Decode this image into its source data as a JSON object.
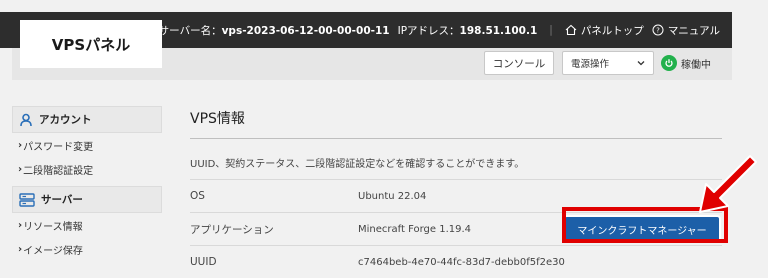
{
  "header": {
    "logo": "VPSパネル",
    "server_label": "サーバー名：",
    "server_name": "vps-2023-06-12-00-00-00-11",
    "ip_label": "IPアドレス：",
    "ip": "198.51.100.1",
    "separator": "|",
    "panel_top": "パネルトップ",
    "manual": "マニュアル"
  },
  "toolbar": {
    "console": "コンソール",
    "power_select": "電源操作",
    "status": "稼働中",
    "status_color": "#22b14c"
  },
  "sidebar": {
    "account_title": "アカウント",
    "account_items": [
      {
        "caret": "›",
        "label": "パスワード変更"
      },
      {
        "caret": "›",
        "label": "二段階認証設定"
      }
    ],
    "server_title": "サーバー",
    "server_items": [
      {
        "caret": "›",
        "label": "リソース情報"
      },
      {
        "caret": "›",
        "label": "イメージ保存"
      }
    ]
  },
  "main": {
    "title": "VPS情報",
    "description": "UUID、契約ステータス、二段階認証設定などを確認することができます。",
    "rows": [
      {
        "key": "OS",
        "value": "Ubuntu 22.04"
      },
      {
        "key": "アプリケーション",
        "value": "Minecraft Forge 1.19.4"
      },
      {
        "key": "UUID",
        "value": "c7464beb-4e70-44fc-83d7-debb0f5f2e30"
      }
    ],
    "app_button": "マインクラフトマネージャー"
  },
  "colors": {
    "accent": "#1c5fa8",
    "highlight": "#e00000",
    "header_bg": "#2d2d2d",
    "icon_blue": "#2a6fb8"
  }
}
